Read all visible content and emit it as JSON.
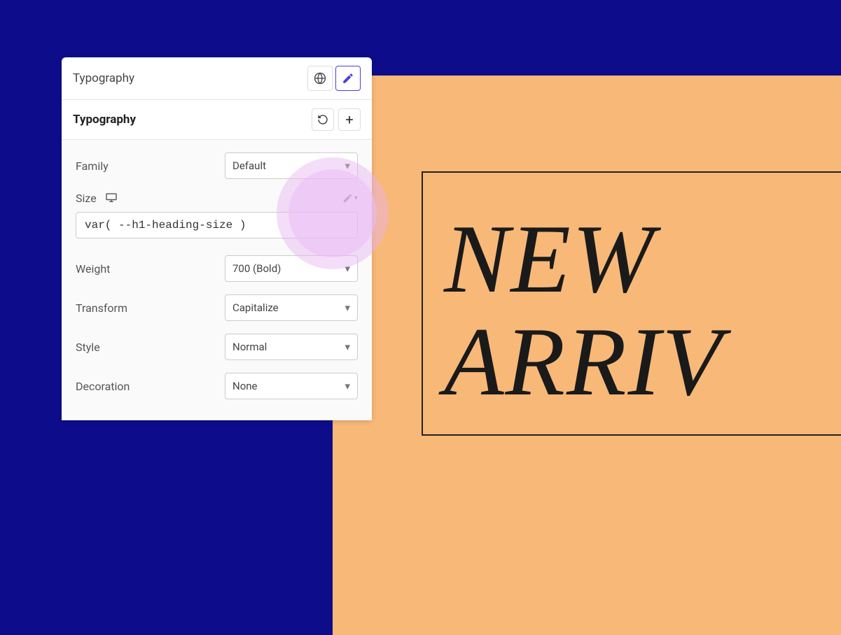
{
  "panel": {
    "title": "Typography",
    "section_title": "Typography",
    "fields": {
      "family": {
        "label": "Family",
        "value": "Default"
      },
      "size": {
        "label": "Size",
        "value": "var( --h1-heading-size )"
      },
      "weight": {
        "label": "Weight",
        "value": "700 (Bold)"
      },
      "transform": {
        "label": "Transform",
        "value": "Capitalize"
      },
      "style": {
        "label": "Style",
        "value": "Normal"
      },
      "decoration": {
        "label": "Decoration",
        "value": "None"
      }
    }
  },
  "preview": {
    "line1": "NEW",
    "line2": "ARRIV"
  },
  "colors": {
    "background": "#0d0d8c",
    "preview_bg": "#f8b877",
    "accent": "#4a3ee8"
  }
}
